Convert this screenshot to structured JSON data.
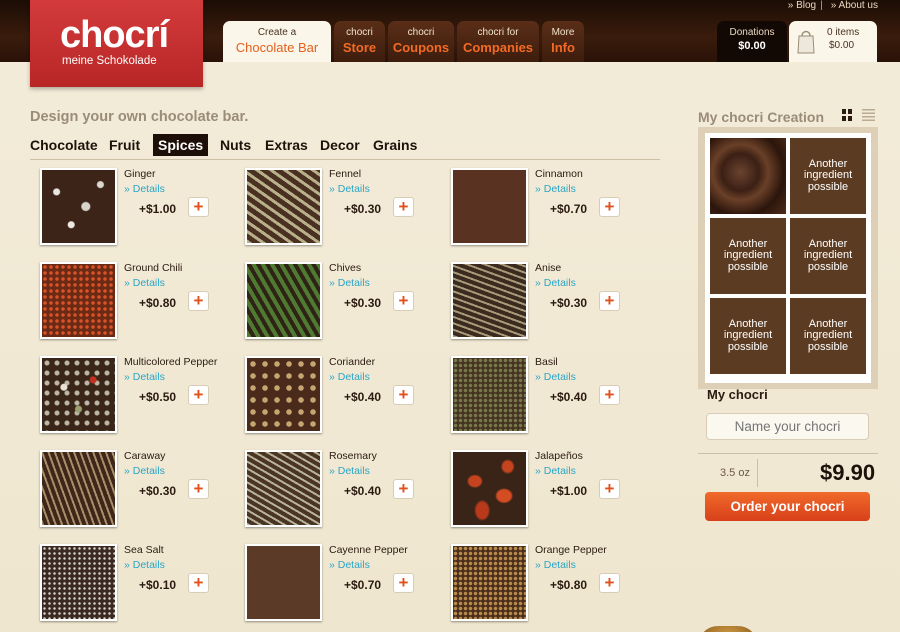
{
  "header": {
    "top_links": [
      "» Blog",
      "» About us"
    ],
    "logo": {
      "word": "chocrí",
      "sub": "meine Schokolade"
    },
    "tabs": [
      {
        "line1": "Create a",
        "line2": "Chocolate Bar",
        "active": true
      },
      {
        "line1": "chocri",
        "line2": "Store",
        "active": false
      },
      {
        "line1": "chocri",
        "line2": "Coupons",
        "active": false
      },
      {
        "line1": "chocri for",
        "line2": "Companies",
        "active": false
      },
      {
        "line1": "More",
        "line2": "Info",
        "active": false
      }
    ],
    "donations": {
      "label": "Donations",
      "amount": "$0.00"
    },
    "cart": {
      "items": "0 items",
      "amount": "$0.00"
    }
  },
  "main": {
    "title": "Design your own chocolate bar.",
    "categories": [
      "Chocolate",
      "Fruit",
      "Spices",
      "Nuts",
      "Extras",
      "Decor",
      "Grains"
    ],
    "active_category": "Spices",
    "details_label": "» Details",
    "items": [
      {
        "name": "Ginger",
        "price": "+$1.00",
        "texture": "ginger"
      },
      {
        "name": "Fennel",
        "price": "+$0.30",
        "texture": "fennel"
      },
      {
        "name": "Cinnamon",
        "price": "+$0.70",
        "texture": "cinnamon"
      },
      {
        "name": "Ground Chili",
        "price": "+$0.80",
        "texture": "chili"
      },
      {
        "name": "Chives",
        "price": "+$0.30",
        "texture": "chives"
      },
      {
        "name": "Anise",
        "price": "+$0.30",
        "texture": "anise"
      },
      {
        "name": "Multicolored Pepper",
        "price": "+$0.50",
        "texture": "pepper"
      },
      {
        "name": "Coriander",
        "price": "+$0.40",
        "texture": "coriander"
      },
      {
        "name": "Basil",
        "price": "+$0.40",
        "texture": "basil"
      },
      {
        "name": "Caraway",
        "price": "+$0.30",
        "texture": "caraway"
      },
      {
        "name": "Rosemary",
        "price": "+$0.40",
        "texture": "rosemary"
      },
      {
        "name": "Jalapeños",
        "price": "+$1.00",
        "texture": "jalapeno"
      },
      {
        "name": "Sea Salt",
        "price": "+$0.10",
        "texture": "salt"
      },
      {
        "name": "Cayenne Pepper",
        "price": "+$0.70",
        "texture": "cayenne"
      },
      {
        "name": "Orange Pepper",
        "price": "+$0.80",
        "texture": "orangepepper"
      }
    ]
  },
  "sidebar": {
    "title": "My chocri Creation",
    "placeholder_cell": "Another ingredient possible",
    "my_chocri_label": "My chocri",
    "name_placeholder": "Name your chocri",
    "weight": "3.5 oz",
    "price": "$9.90",
    "order_label": "Order your chocri"
  },
  "colors": {
    "accent": "#f06a2a",
    "brand_red": "#d33b3b",
    "link": "#2aa5c8",
    "header_dark": "#2a1208"
  }
}
